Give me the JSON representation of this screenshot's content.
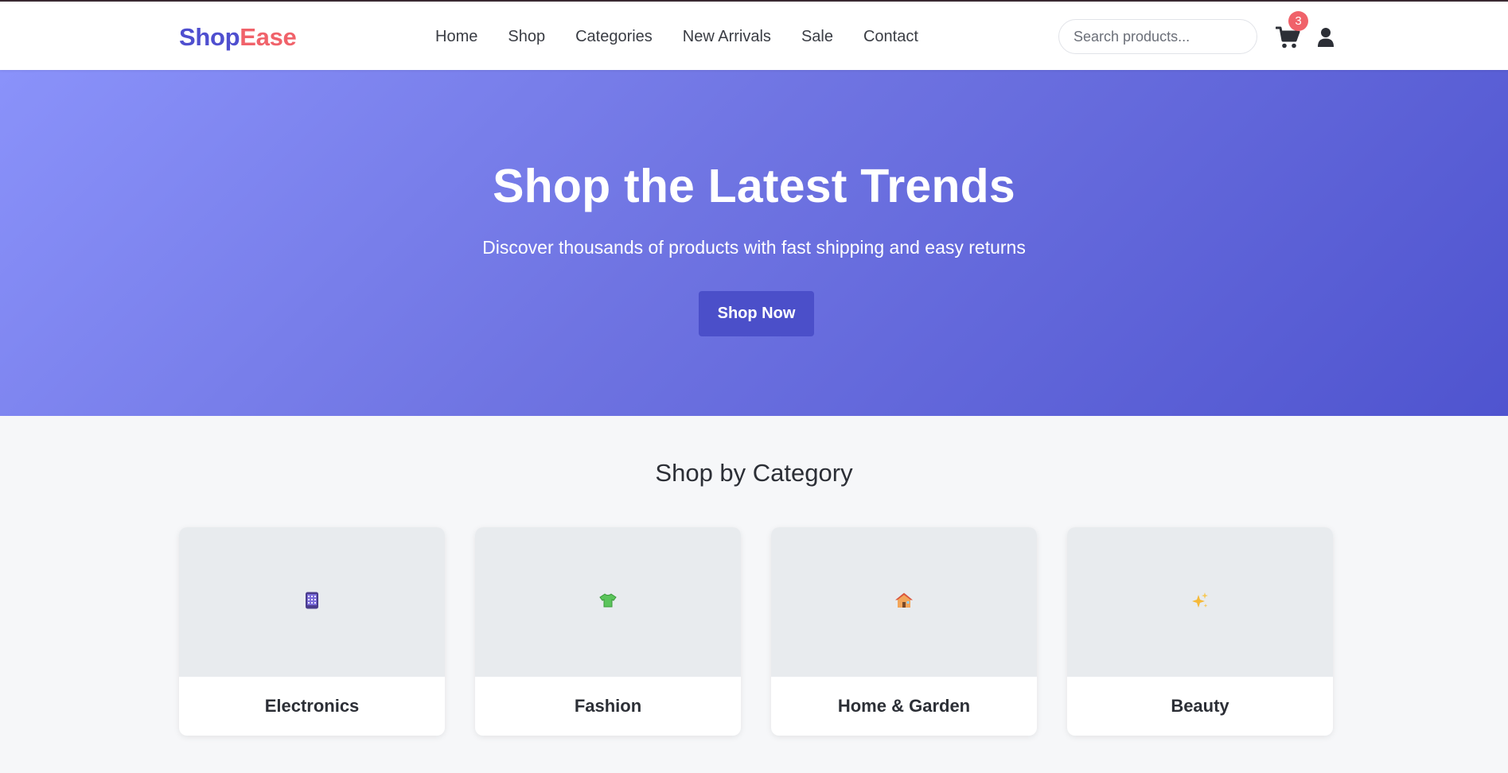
{
  "header": {
    "logo_part1": "Shop",
    "logo_part2": "Ease",
    "nav": [
      "Home",
      "Shop",
      "Categories",
      "New Arrivals",
      "Sale",
      "Contact"
    ],
    "search_placeholder": "Search products...",
    "cart_count": "3",
    "cart_icon": "cart-icon",
    "user_icon": "user-icon"
  },
  "hero": {
    "title": "Shop the Latest Trends",
    "subtitle": "Discover thousands of products with fast shipping and easy returns",
    "cta_label": "Shop Now"
  },
  "categories": {
    "heading": "Shop by Category",
    "items": [
      {
        "name": "Electronics",
        "icon": "phone-icon"
      },
      {
        "name": "Fashion",
        "icon": "shirt-icon"
      },
      {
        "name": "Home & Garden",
        "icon": "house-icon"
      },
      {
        "name": "Beauty",
        "icon": "sparkles-icon"
      }
    ]
  },
  "colors": {
    "brand_primary": "#4f4fcf",
    "brand_accent": "#f0626a",
    "hero_gradient_start": "#8a92fa",
    "hero_gradient_end": "#4f54cf",
    "button": "#4b4fc9"
  }
}
